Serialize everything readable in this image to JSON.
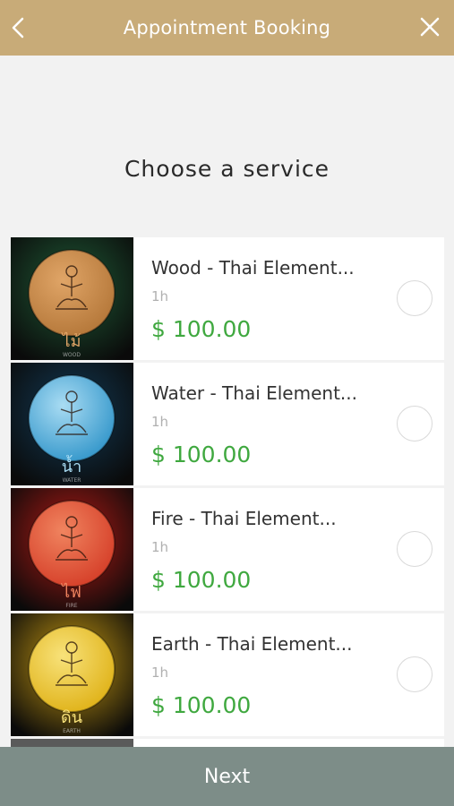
{
  "header": {
    "title": "Appointment Booking",
    "back_icon": "chevron-left-icon",
    "close_icon": "close-icon"
  },
  "main": {
    "heading": "Choose a service"
  },
  "colors": {
    "header": "#c8ab78",
    "price": "#3fa83f",
    "footer": "#7d8d88"
  },
  "services": [
    {
      "name": "Wood - Thai Element...",
      "duration": "1h",
      "price": "$ 100.00",
      "thai_label": "ไม้",
      "element_label": "WOOD",
      "bg": "#1f5a36",
      "orb": "#b77a3c",
      "orb_light": "#e0a567",
      "selected": false
    },
    {
      "name": "Water - Thai Element...",
      "duration": "1h",
      "price": "$ 100.00",
      "thai_label": "น้ำ",
      "element_label": "WATER",
      "bg": "#123a55",
      "orb": "#3b9bcd",
      "orb_light": "#a9dcf3",
      "selected": false
    },
    {
      "name": "Fire - Thai Element...",
      "duration": "1h",
      "price": "$ 100.00",
      "thai_label": "ไฟ",
      "element_label": "FIRE",
      "bg": "#b31a15",
      "orb": "#d7432c",
      "orb_light": "#f0845f",
      "selected": false
    },
    {
      "name": "Earth - Thai Element...",
      "duration": "1h",
      "price": "$ 100.00",
      "thai_label": "ดิน",
      "element_label": "EARTH",
      "bg": "#c79a12",
      "orb": "#e1b51e",
      "orb_light": "#f8e27a",
      "selected": false
    }
  ],
  "footer": {
    "next_label": "Next"
  }
}
